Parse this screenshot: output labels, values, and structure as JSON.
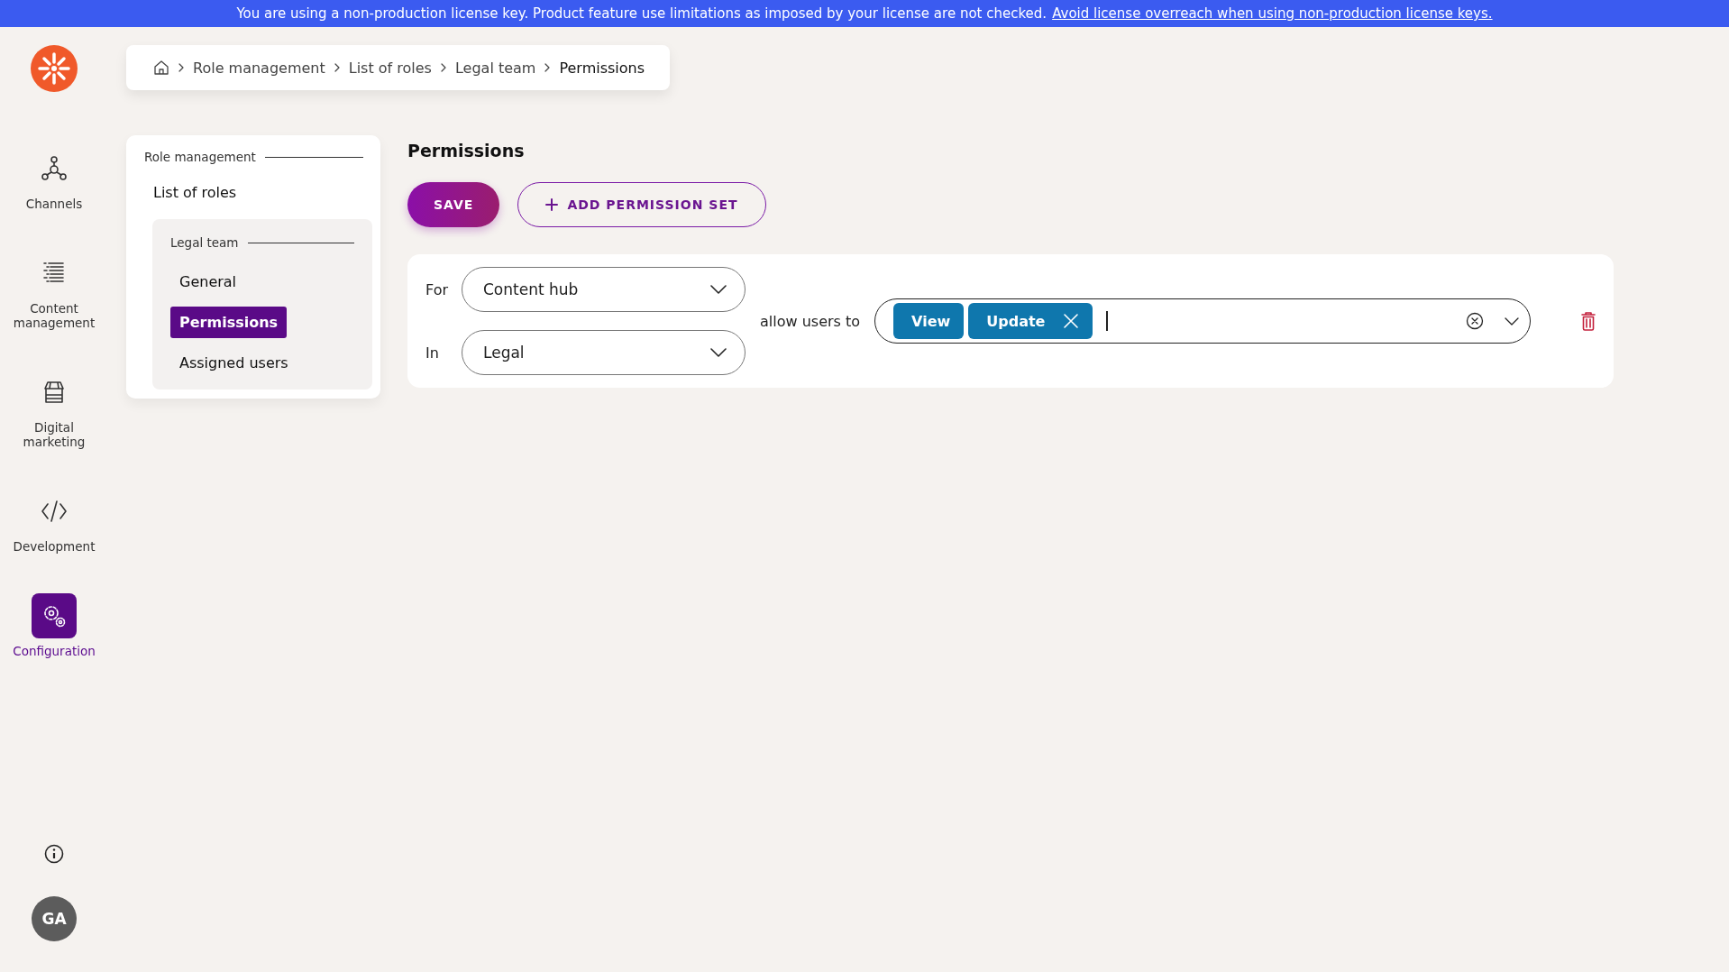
{
  "banner": {
    "text": "You are using a non-production license key. Product feature use limitations as imposed by your license are not checked.",
    "link": "Avoid license overreach when using non-production license keys."
  },
  "rail": {
    "items": [
      {
        "label": "Channels",
        "kind": "channels",
        "selected": false
      },
      {
        "label": "Content management",
        "kind": "content",
        "selected": false
      },
      {
        "label": "Digital marketing",
        "kind": "marketing",
        "selected": false
      },
      {
        "label": "Development",
        "kind": "development",
        "selected": false
      },
      {
        "label": "Configuration",
        "kind": "configuration",
        "selected": true
      }
    ],
    "avatar": "GA"
  },
  "breadcrumb": [
    "Role management",
    "List of roles",
    "Legal team",
    "Permissions"
  ],
  "nav": {
    "section": "Role management",
    "link": "List of roles",
    "group": {
      "title": "Legal team",
      "items": [
        {
          "label": "General",
          "selected": false
        },
        {
          "label": "Permissions",
          "selected": true
        },
        {
          "label": "Assigned users",
          "selected": false
        }
      ]
    }
  },
  "page": {
    "title": "Permissions",
    "save": "SAVE",
    "add": "ADD PERMISSION SET"
  },
  "permission_sets": [
    {
      "for_label": "For",
      "for_value": "Content hub",
      "in_label": "In",
      "in_value": "Legal",
      "allow_label": "allow users to",
      "tags": [
        {
          "label": "View",
          "removable": false
        },
        {
          "label": "Update",
          "removable": true
        }
      ]
    }
  ]
}
